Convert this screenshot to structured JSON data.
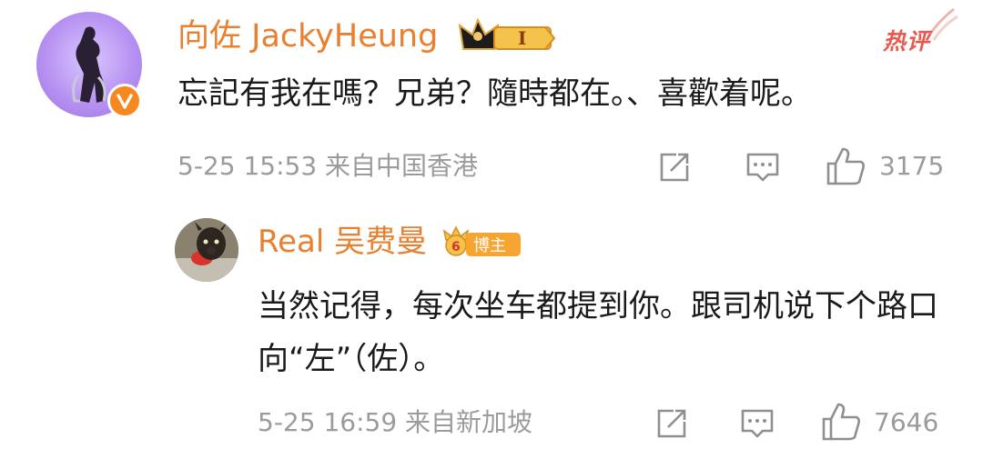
{
  "main_comment": {
    "username": "向佐 JackyHeung",
    "level_badge": "I",
    "hot_label": "热评",
    "text": "忘記有我在嗎？兄弟？隨時都在。、喜歡着呢。",
    "date": "5-25 15:53",
    "source": "来自中国香港",
    "like_count": "3175",
    "accent_color": "#e8802f",
    "verified_icon": "verified-v-icon"
  },
  "reply": {
    "username": "Real 吴费曼",
    "badge_label": "博主",
    "text": "当然记得，每次坐车都提到你。跟司机说下个路口向“左”（佐）。",
    "date": "5-25 16:59",
    "source": "来自新加坡",
    "like_count": "7646"
  },
  "icons": [
    "share-icon",
    "comment-icon",
    "like-icon"
  ]
}
